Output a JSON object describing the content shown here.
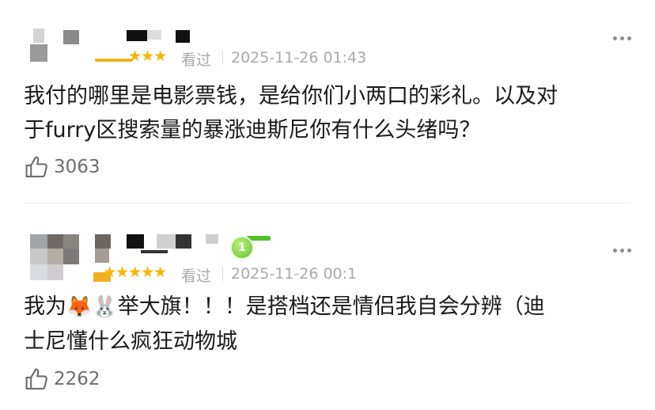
{
  "comments": [
    {
      "rating_stars": "★★★",
      "watched_label": "看过",
      "date": "2025-11-26 01:43",
      "text_line1": "我付的哪里是电影票钱，是给你们小两口的彩礼。以及对",
      "text_line2": "于furry区搜索量的暴涨迪斯尼你有什么头绪吗？",
      "likes": "3063"
    },
    {
      "rating_stars": "★★★★★",
      "watched_label": "看过",
      "date": "2025-11-26 00:1",
      "level_badge": "1",
      "text_line1_a": "我为",
      "emoji_fox": "🦊",
      "emoji_rabbit": "🐰",
      "text_line1_b": "举大旗！！！是搭档还是情侣我自会分辨（迪",
      "text_line2": "士尼懂什么疯狂动物城",
      "likes": "2262"
    }
  ],
  "colors": {
    "star": "#f7b500",
    "meta_gray": "#a9a9a9",
    "like_gray": "#6e6e6e",
    "badge_green": "#62c02e"
  },
  "icons": [
    "more-dots-icon",
    "thumbs-up-icon",
    "star-icon",
    "level-badge-icon"
  ]
}
